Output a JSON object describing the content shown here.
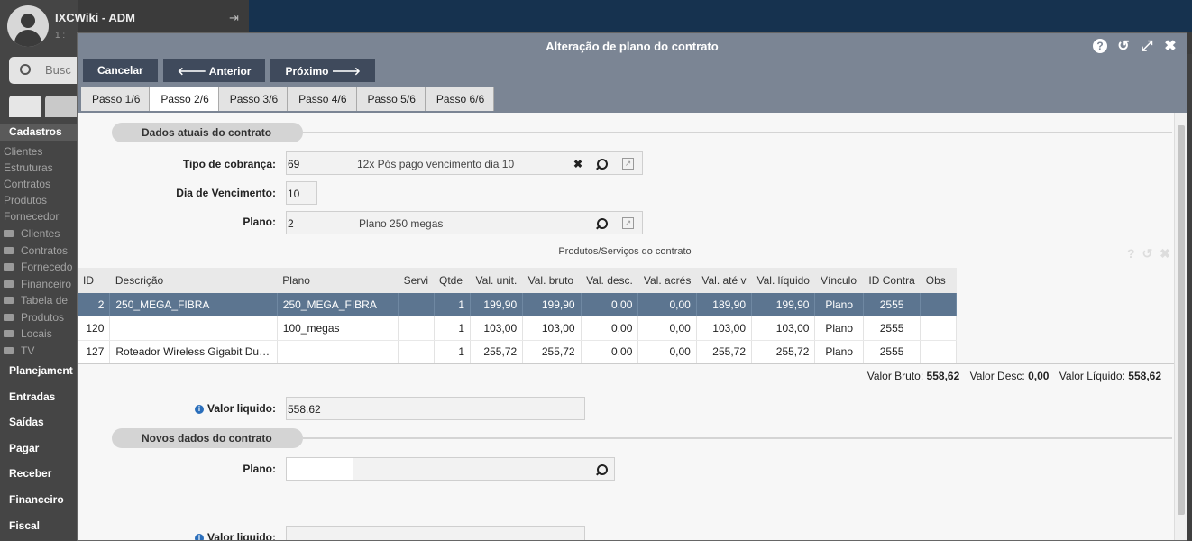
{
  "background": {
    "user": "IXCWiki - ADM",
    "user_sub": "1 :",
    "search_placeholder": "Busc",
    "menu_heading": "Cadastros",
    "links": [
      "Clientes",
      "Estruturas",
      "Contratos",
      "Produtos",
      "Fornecedor"
    ],
    "folders": [
      "Clientes",
      "Contratos",
      "Fornecedo",
      "Financeiro",
      "Tabela de",
      "Produtos",
      "Locais",
      "TV"
    ],
    "sections": [
      "Planejament",
      "Entradas",
      "Saídas",
      "Pagar",
      "Receber",
      "Financeiro",
      "Fiscal"
    ]
  },
  "modal": {
    "title": "Alteração de plano do contrato",
    "toolbar": {
      "cancel": "Cancelar",
      "prev": "🡐 Anterior",
      "next": "Próximo 🡒"
    },
    "steps": [
      "Passo 1/6",
      "Passo 2/6",
      "Passo 3/6",
      "Passo 4/6",
      "Passo 5/6",
      "Passo 6/6"
    ],
    "active_step": 1,
    "current": {
      "section_title": "Dados atuais do contrato",
      "tipo_cobranca_label": "Tipo de cobrança:",
      "tipo_cobranca_code": "69",
      "tipo_cobranca_desc": "12x Pós pago  vencimento dia 10",
      "dia_vencimento_label": "Dia de Vencimento:",
      "dia_vencimento": "10",
      "plano_label": "Plano:",
      "plano_code": "2",
      "plano_desc": "Plano 250 megas",
      "grid_title": "Produtos/Serviços do contrato",
      "columns": [
        "ID",
        "Descrição",
        "Plano",
        "Servi",
        "Qtde",
        "Val. unit.",
        "Val. bruto",
        "Val. desc.",
        "Val. acrés",
        "Val. até v",
        "Val. líquido",
        "Vínculo",
        "ID Contra",
        "Obs"
      ],
      "rows": [
        {
          "id": "2",
          "descricao": "250_MEGA_FIBRA",
          "plano": "250_MEGA_FIBRA",
          "servi": "",
          "qtde": "1",
          "unit": "199,90",
          "bruto": "199,90",
          "desc": "0,00",
          "acres": "0,00",
          "ate": "189,90",
          "liquido": "199,90",
          "vinculo": "Plano",
          "id_contrato": "2555",
          "obs": ""
        },
        {
          "id": "120",
          "descricao": "",
          "plano": "100_megas",
          "servi": "",
          "qtde": "1",
          "unit": "103,00",
          "bruto": "103,00",
          "desc": "0,00",
          "acres": "0,00",
          "ate": "103,00",
          "liquido": "103,00",
          "vinculo": "Plano",
          "id_contrato": "2555",
          "obs": ""
        },
        {
          "id": "127",
          "descricao": "Roteador Wireless Gigabit Du…",
          "plano": "",
          "servi": "",
          "qtde": "1",
          "unit": "255,72",
          "bruto": "255,72",
          "desc": "0,00",
          "acres": "0,00",
          "ate": "255,72",
          "liquido": "255,72",
          "vinculo": "Plano",
          "id_contrato": "2555",
          "obs": ""
        }
      ],
      "totals": {
        "bruto_label": "Valor Bruto:",
        "bruto": "558,62",
        "desc_label": "Valor Desc:",
        "desc": "0,00",
        "liquido_label": "Valor Líquido:",
        "liquido": "558,62"
      },
      "valor_liquido_label": "Valor liquido:",
      "valor_liquido": "558.62"
    },
    "new": {
      "section_title": "Novos dados do contrato",
      "plano_label": "Plano:",
      "plano_code": "",
      "valor_liquido_label": "Valor liquido:"
    }
  },
  "colors": {
    "header": "#7b8594",
    "button": "#3f4a5c",
    "selected_row": "#5c7590",
    "info": "#2a6ebb"
  }
}
